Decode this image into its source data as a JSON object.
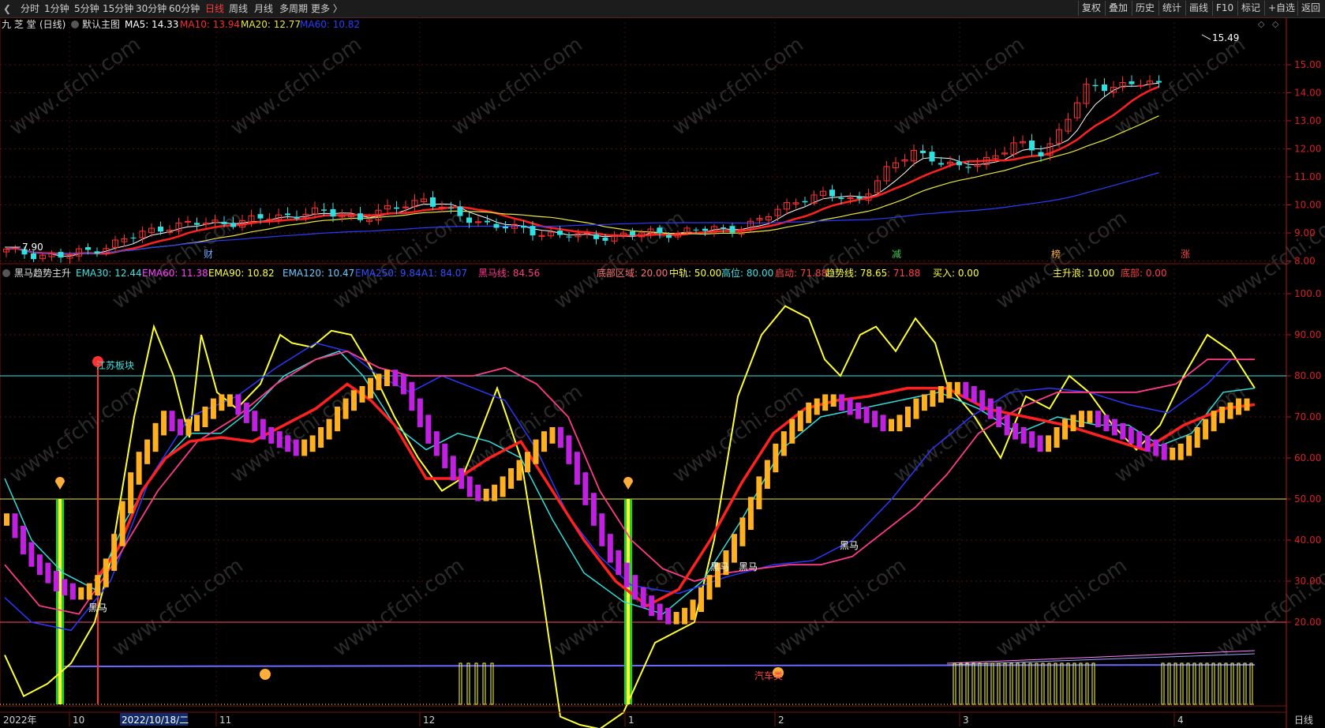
{
  "toolbar": {
    "back_glyph": "❮",
    "periods": [
      "分时",
      "1分钟",
      "5分钟",
      "15分钟",
      "30分钟",
      "60分钟",
      "日线",
      "周线",
      "月线",
      "多周期",
      "更多 〉"
    ],
    "active_period": "日线",
    "right_buttons": [
      "复权",
      "叠加",
      "历史",
      "统计",
      "画线",
      "F10",
      "标记",
      "+自选",
      "返回"
    ]
  },
  "main": {
    "stock_name": "九 芝 堂",
    "period_tag": "(日线)",
    "indicator_name": "默认主图",
    "ma": [
      {
        "label": "MA5: 14.33",
        "color": "#ffffff"
      },
      {
        "label": "MA10: 13.94",
        "color": "#ff2a2a"
      },
      {
        "label": "MA20: 12.77",
        "color": "#e8e83a"
      },
      {
        "label": "MA60: 10.82",
        "color": "#2a3cff"
      }
    ],
    "y_ticks": [
      "15.00",
      "14.00",
      "13.00",
      "12.00",
      "11.00",
      "10.00",
      "9.00",
      "8.00"
    ],
    "high_label": "15.49",
    "low_label": "7.90",
    "events": [
      {
        "text": "财",
        "color": "#6fa8ff"
      },
      {
        "text": "减",
        "color": "#3fd24b"
      },
      {
        "text": "榜",
        "color": "#ffae3a"
      },
      {
        "text": "涨",
        "color": "#ff4040"
      }
    ],
    "top_right_glyph": "◇"
  },
  "sub": {
    "indicator_name": "黑马趋势主升",
    "values": [
      {
        "label": "EMA30: 12.44",
        "color": "#3fe0e0"
      },
      {
        "label": "EMA60: 11.38",
        "color": "#ff40ff"
      },
      {
        "label": "EMA90: 10.82",
        "color": "#ffff40"
      },
      {
        "label": "EMA120: 10.47",
        "color": "#6fc8ff"
      },
      {
        "label": "EMA250: 9.84",
        "color": "#3050ff"
      },
      {
        "label": "A1: 84.07",
        "color": "#3050ff"
      },
      {
        "label": "黑马线: 84.56",
        "color": "#ff3a8a"
      }
    ],
    "values2": [
      {
        "label": "底部区域: 20.00",
        "color": "#ff7070"
      },
      {
        "label": "中轨: 50.00",
        "color": "#ffff40"
      },
      {
        "label": "高位: 80.00",
        "color": "#3fe0e0"
      },
      {
        "label": "启动: 71.88",
        "color": "#ff4040"
      },
      {
        "label": "趋势线: 78.65",
        "color": "#ffff40"
      },
      {
        "label": ": 71.88",
        "color": "#ff4040"
      },
      {
        "label": "买入: 0.00",
        "color": "#ffff40"
      },
      {
        "label": "主升浪: 10.00",
        "color": "#ffff40"
      },
      {
        "label": "底部: 0.00",
        "color": "#ff4040"
      }
    ],
    "y_ticks": [
      "100.0",
      "90.00",
      "80.00",
      "70.00",
      "60.00",
      "50.00",
      "40.00",
      "30.00",
      "20.00"
    ],
    "annotations": {
      "block": "江苏板块",
      "horse": "黑马",
      "auto": "汽车类"
    }
  },
  "xaxis": {
    "labels": [
      "2022年",
      "10",
      "2022/10/18/二",
      "11",
      "12",
      "1",
      "2",
      "3",
      "4"
    ],
    "right_label": "日线"
  },
  "watermark": "www.cfchi.com"
}
